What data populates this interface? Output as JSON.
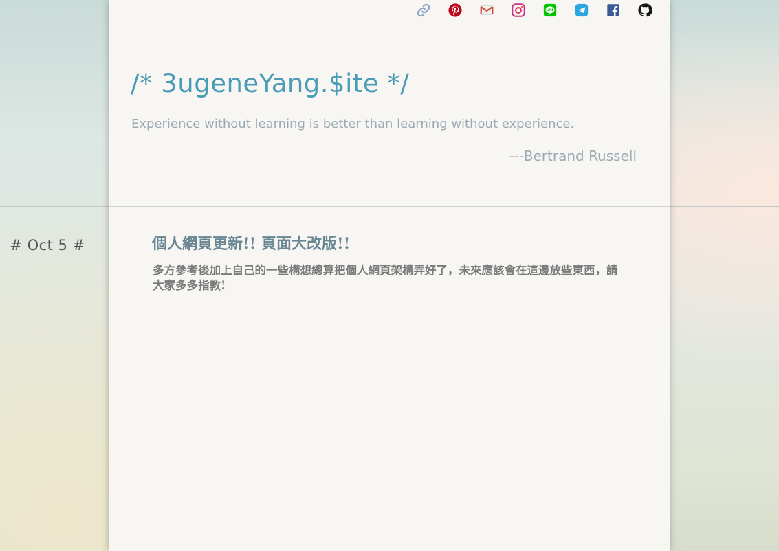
{
  "site": {
    "title": "/* 3ugeneYang.$ite */",
    "quote": "Experience without learning is better than learning without experience.",
    "quote_author": "---Bertrand Russell"
  },
  "social_icons": [
    {
      "name": "link-icon",
      "color": "#8fa5c9"
    },
    {
      "name": "pinterest-icon",
      "color": "#bd081c"
    },
    {
      "name": "gmail-icon",
      "color": "#d44638"
    },
    {
      "name": "instagram-icon",
      "color": "#c13584"
    },
    {
      "name": "line-icon",
      "color": "#00c300"
    },
    {
      "name": "telegram-icon",
      "color": "#2ca5e0"
    },
    {
      "name": "facebook-icon",
      "color": "#3b5998"
    },
    {
      "name": "github-icon",
      "color": "#181717"
    }
  ],
  "post": {
    "date": "# Oct 5 #",
    "title": "個人網頁更新!! 頁面大改版!!",
    "body": "多方參考後加上自己的一些構想總算把個人網頁架構弄好了，未來應該會在這邊放些東西，請大家多多指教!"
  },
  "colors": {
    "title": "#4a9bb6",
    "quote": "#9aaab4",
    "post_title": "#6b8794",
    "post_body": "#7a7a7a",
    "page_bg": "#f7f6f3"
  }
}
